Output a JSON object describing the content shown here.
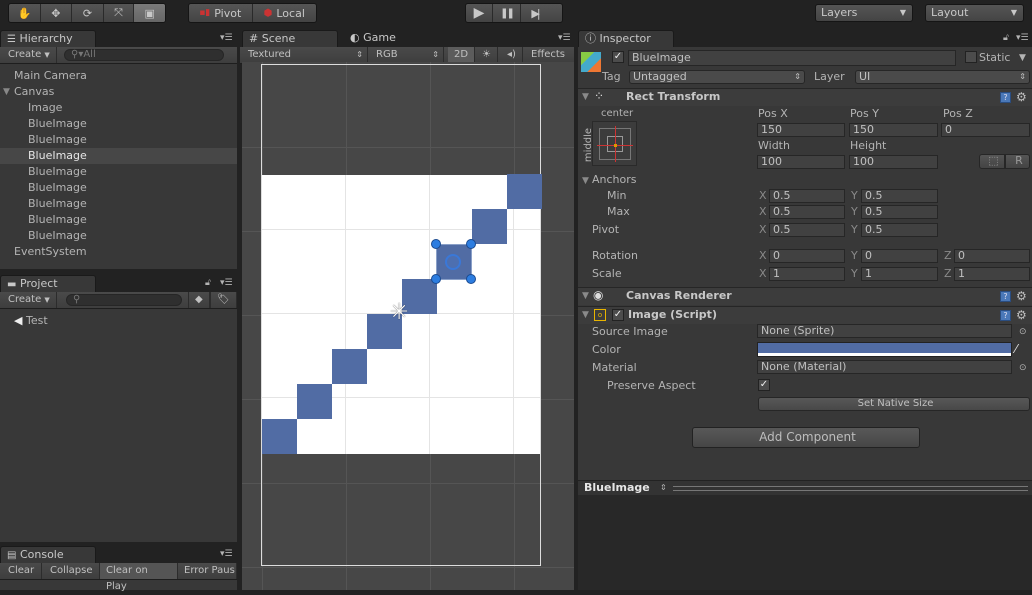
{
  "toolbar": {
    "tools": [
      {
        "name": "hand-tool",
        "glyph": "✋",
        "active": false
      },
      {
        "name": "move-tool",
        "glyph": "✥",
        "active": false
      },
      {
        "name": "rotate-tool",
        "glyph": "⟳",
        "active": false
      },
      {
        "name": "scale-tool",
        "glyph": "⤧",
        "active": false
      },
      {
        "name": "rect-tool",
        "glyph": "▣",
        "active": true
      }
    ],
    "pivot_label": "Pivot",
    "local_label": "Local",
    "play_glyph": "▶",
    "pause_glyph": "❚❚",
    "step_glyph": "▶|",
    "layers_label": "Layers",
    "layout_label": "Layout"
  },
  "hierarchy": {
    "tab_label": "Hierarchy",
    "create_label": "Create",
    "search_placeholder": "All",
    "items": [
      {
        "label": "Main Camera",
        "indent": 0,
        "selected": false
      },
      {
        "label": "Canvas",
        "indent": 0,
        "selected": false,
        "expanded": true
      },
      {
        "label": "Image",
        "indent": 1,
        "selected": false
      },
      {
        "label": "BlueImage",
        "indent": 1,
        "selected": false
      },
      {
        "label": "BlueImage",
        "indent": 1,
        "selected": false
      },
      {
        "label": "BlueImage",
        "indent": 1,
        "selected": true
      },
      {
        "label": "BlueImage",
        "indent": 1,
        "selected": false
      },
      {
        "label": "BlueImage",
        "indent": 1,
        "selected": false
      },
      {
        "label": "BlueImage",
        "indent": 1,
        "selected": false
      },
      {
        "label": "BlueImage",
        "indent": 1,
        "selected": false
      },
      {
        "label": "BlueImage",
        "indent": 1,
        "selected": false
      },
      {
        "label": "EventSystem",
        "indent": 0,
        "selected": false
      }
    ]
  },
  "project": {
    "tab_label": "Project",
    "create_label": "Create",
    "search_placeholder": "",
    "items": [
      {
        "label": "Test"
      }
    ]
  },
  "console": {
    "tab_label": "Console",
    "buttons": [
      "Clear",
      "Collapse",
      "Clear on Play",
      "Error Paus"
    ]
  },
  "scene": {
    "tab_scene": "Scene",
    "tab_game": "Game",
    "shading_mode": "Textured",
    "render_mode": "RGB",
    "mode_2d": "2D",
    "effects_label": "Effects",
    "image_color": "#516ca4",
    "canvas_bg": "#ffffff"
  },
  "inspector": {
    "tab_label": "Inspector",
    "object_name": "BlueImage",
    "active": true,
    "static_label": "Static",
    "static": false,
    "tag_label": "Tag",
    "tag_value": "Untagged",
    "layer_label": "Layer",
    "layer_value": "UI",
    "rect_transform": {
      "title": "Rect Transform",
      "anchor_h": "center",
      "anchor_v": "middle",
      "pos_x_label": "Pos X",
      "pos_x": "150",
      "pos_y_label": "Pos Y",
      "pos_y": "150",
      "pos_z_label": "Pos Z",
      "pos_z": "0",
      "width_label": "Width",
      "width": "100",
      "height_label": "Height",
      "height": "100",
      "blueprint_btn": "⬚",
      "raw_btn": "R",
      "anchors_label": "Anchors",
      "min_label": "Min",
      "min_x": "0.5",
      "min_y": "0.5",
      "max_label": "Max",
      "max_x": "0.5",
      "max_y": "0.5",
      "pivot_label": "Pivot",
      "pivot_x": "0.5",
      "pivot_y": "0.5",
      "rotation_label": "Rotation",
      "rot_x": "0",
      "rot_y": "0",
      "rot_z": "0",
      "scale_label": "Scale",
      "scale_x": "1",
      "scale_y": "1",
      "scale_z": "1",
      "axis_x": "X",
      "axis_y": "Y",
      "axis_z": "Z"
    },
    "canvas_renderer": {
      "title": "Canvas Renderer"
    },
    "image": {
      "title": "Image (Script)",
      "enabled": true,
      "source_image_label": "Source Image",
      "source_image": "None (Sprite)",
      "color_label": "Color",
      "color": "#516ca4",
      "material_label": "Material",
      "material": "None (Material)",
      "preserve_aspect_label": "Preserve Aspect",
      "preserve_aspect": true,
      "set_native_size": "Set Native Size"
    },
    "add_component": "Add Component",
    "preview_title": "BlueImage"
  }
}
